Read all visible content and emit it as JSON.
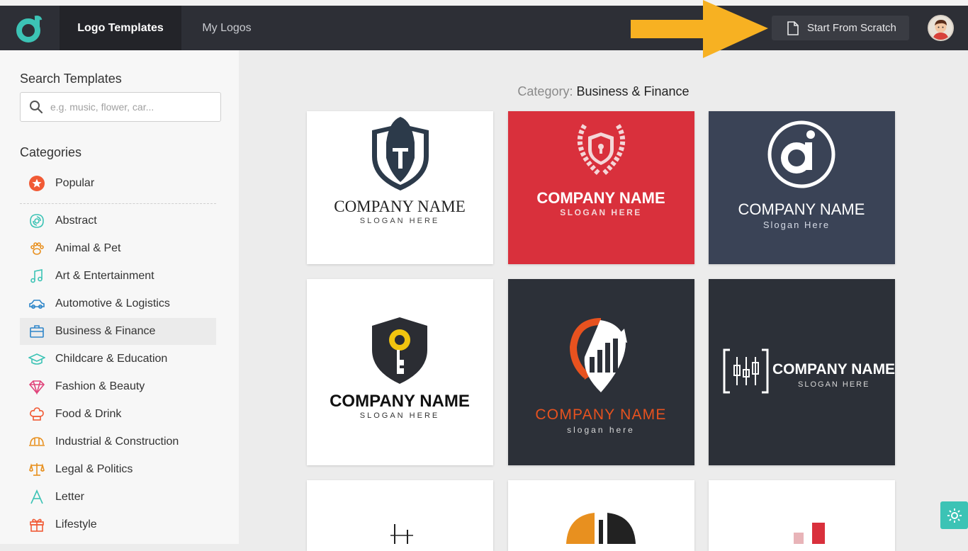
{
  "nav": {
    "tabs": [
      {
        "label": "Logo Templates",
        "active": true
      },
      {
        "label": "My Logos",
        "active": false
      }
    ],
    "start_button": "Start From Scratch"
  },
  "sidebar": {
    "search_title": "Search Templates",
    "search_placeholder": "e.g. music, flower, car...",
    "categories_title": "Categories",
    "items": [
      {
        "label": "Popular",
        "icon": "star-icon"
      },
      {
        "label": "Abstract",
        "icon": "abstract-icon"
      },
      {
        "label": "Animal & Pet",
        "icon": "paw-icon"
      },
      {
        "label": "Art & Entertainment",
        "icon": "music-note-icon"
      },
      {
        "label": "Automotive & Logistics",
        "icon": "car-icon"
      },
      {
        "label": "Business & Finance",
        "icon": "briefcase-icon",
        "selected": true
      },
      {
        "label": "Childcare & Education",
        "icon": "graduation-cap-icon"
      },
      {
        "label": "Fashion & Beauty",
        "icon": "diamond-icon"
      },
      {
        "label": "Food & Drink",
        "icon": "chef-hat-icon"
      },
      {
        "label": "Industrial & Construction",
        "icon": "hard-hat-icon"
      },
      {
        "label": "Legal & Politics",
        "icon": "scales-icon"
      },
      {
        "label": "Letter",
        "icon": "letter-a-icon"
      },
      {
        "label": "Lifestyle",
        "icon": "gift-icon"
      }
    ]
  },
  "main": {
    "category_label": "Category",
    "category_value": "Business & Finance",
    "templates": [
      {
        "name": "COMPANY NAME",
        "slogan": "SLOGAN HERE",
        "bg": "#ffffff"
      },
      {
        "name": "COMPANY NAME",
        "slogan": "SLOGAN HERE",
        "bg": "#d9303c"
      },
      {
        "name": "COMPANY NAME",
        "slogan": "Slogan Here",
        "bg": "#3a4356"
      },
      {
        "name": "COMPANY NAME",
        "slogan": "SLOGAN HERE",
        "bg": "#ffffff"
      },
      {
        "name": "COMPANY NAME",
        "slogan": "slogan here",
        "bg": "#2c3038"
      },
      {
        "name": "COMPANY NAME",
        "slogan": "SLOGAN HERE",
        "bg": "#2c3038"
      }
    ]
  },
  "colors": {
    "topbar": "#2d2f36",
    "accent_teal": "#3cc3b5",
    "arrow": "#f7b122",
    "red": "#d9303c",
    "orange": "#e8521f"
  }
}
